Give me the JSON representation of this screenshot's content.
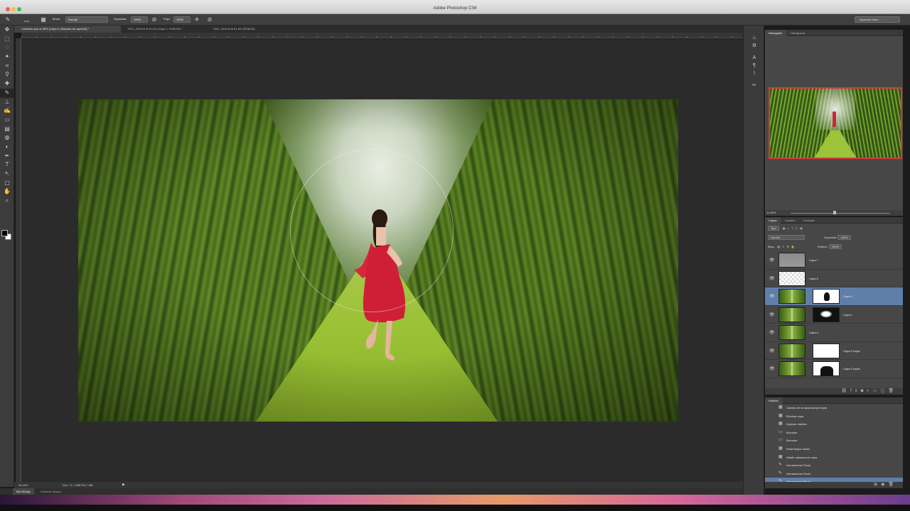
{
  "window": {
    "title": "Adobe Photoshop CS6"
  },
  "options_bar": {
    "mode_label": "Modo:",
    "mode_value": "Normal",
    "opacity_label": "Opacidad:",
    "opacity_value": "100%",
    "flow_label": "Flujo:",
    "flow_value": "100%",
    "brush_size": "1443",
    "workspace": "Aspectos esen..."
  },
  "document_tabs": [
    {
      "label": "Laberinto.psd al 35% (Capa 9, Máscara de capa/16) *"
    },
    {
      "label": "DSC_5343.tif al 30,1% (Capa 1, RGB/16) *"
    },
    {
      "label": "DSC_5318.tif al 81,8% (RGB/16)"
    }
  ],
  "status_bar": {
    "zoom": "34,99%",
    "doc": "Doc: 71,7 MB/794,7 MB"
  },
  "bottom_tabs": [
    {
      "label": "Mini Bridge"
    },
    {
      "label": "Línea de tiempo"
    }
  ],
  "navigator": {
    "tabs": [
      {
        "label": "Navegador"
      },
      {
        "label": "Histograma"
      }
    ],
    "zoom": "34,99%"
  },
  "layers_panel": {
    "tabs": [
      {
        "label": "Capas"
      },
      {
        "label": "Canales"
      },
      {
        "label": "Trazados"
      }
    ],
    "filter": "Tipo",
    "blend_mode": "Normal",
    "opacity_label": "Opacidad:",
    "opacity_value": "100%",
    "lock_label": "Bloq.:",
    "fill_label": "Relleno:",
    "fill_value": "100%",
    "layers": [
      {
        "name": "Capa 7"
      },
      {
        "name": "Capa 6"
      },
      {
        "name": "Capa 9"
      },
      {
        "name": "Capa 1"
      },
      {
        "name": "Capa 4"
      },
      {
        "name": "Capa 3 copia"
      },
      {
        "name": "Capa 3 copia"
      }
    ]
  },
  "history_panel": {
    "tab": "Historia",
    "items": [
      {
        "label": "Cambio de la opacidad principal"
      },
      {
        "label": "Eliminar capa"
      },
      {
        "label": "Duplicar visibles"
      },
      {
        "label": "Borrador"
      },
      {
        "label": "Borrador"
      },
      {
        "label": "Desenfoque radial"
      },
      {
        "label": "Añadir máscara de capa"
      },
      {
        "label": "Herramienta Pincel"
      },
      {
        "label": "Herramienta Pincel"
      },
      {
        "label": "Herramienta Pincel"
      }
    ]
  },
  "icons": {
    "eye": "👁",
    "brush": "✎",
    "move": "✥",
    "marquee": "⬚",
    "lasso": "◌",
    "wand": "✦",
    "crop": "⌗",
    "eyedropper": "⚲",
    "heal": "✚",
    "stamp": "⊥",
    "eraser": "▭",
    "gradient": "▤",
    "blur": "◍",
    "dodge": "◐",
    "pen": "✒",
    "type": "T",
    "path": "↖",
    "shape": "▢",
    "hand": "✋",
    "zoom": "⌕",
    "history_brush": "✍",
    "trash": "🗑"
  },
  "colors": {
    "selection": "#5f7fa8",
    "navigator_frame": "#d33b3b"
  }
}
